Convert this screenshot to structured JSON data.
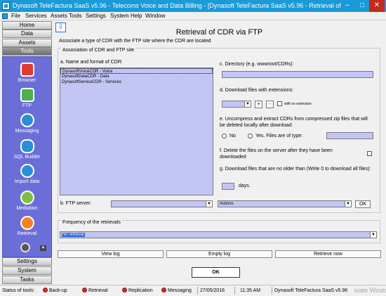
{
  "window": {
    "title": "Dynasoft TeleFactura SaaS v5.96 - Telecoms Voice and Data Billing - [Dynasoft TeleFactura SaaS v5.96 - Retrieval of CDR v",
    "minimize": "–",
    "maximize": "□",
    "close": "✕"
  },
  "menu": [
    "File",
    "Services",
    "Assets",
    "Tools",
    "Settings",
    "System",
    "Help",
    "Window"
  ],
  "sidebar": {
    "sections_top": [
      "Home",
      "Data",
      "Assets",
      "Tools"
    ],
    "tools": [
      {
        "label": "Browser",
        "icon": "browser-icon"
      },
      {
        "label": "FTP",
        "icon": "ftp-icon"
      },
      {
        "label": "Messaging",
        "icon": "messaging-icon"
      },
      {
        "label": "SQL Builder",
        "icon": "sql-builder-icon"
      },
      {
        "label": "Import data",
        "icon": "import-data-icon"
      },
      {
        "label": "Mediation",
        "icon": "mediation-icon"
      },
      {
        "label": "Retrieval",
        "icon": "retrieval-icon"
      }
    ],
    "sections_bottom": [
      "Settings",
      "System",
      "Tasks"
    ],
    "dropdown_arrow": "▼"
  },
  "main": {
    "back_arrow": "⇩",
    "title": "Retrieval of CDR via FTP",
    "description": "Associate a type of CDR with the FTP site where the CDR are located",
    "association_legend": "Association of CDR and FTP site",
    "cdr_label": "a. Name and format of CDR:",
    "cdr_items": [
      "DynasoftVoiceCDR - Voice",
      "DynasoftDataCDR - Data",
      "DynasoftServiceCDR - Services"
    ],
    "ftp_server_label": "b. FTP server:",
    "ftp_server_value": "",
    "directory_label": "c. Directory (e.g. wwwroot/CDRs):",
    "directory_value": "",
    "extensions_label": "d. Download files with extensions:",
    "extension_value": "",
    "plus_label": "+",
    "minus_label": "-",
    "no_extension_label": "with no extension",
    "uncompress_label": "e. Uncompress and extract CDRs from compressed zip files that will be deleted locally after download:",
    "radio_no": "No",
    "radio_yes": "Yes. Files are of type:",
    "file_type_value": "",
    "delete_label": "f. Delete the files on the server after they have been downloaded",
    "older_label": "g. Download files that are no older than (Write 0 to download all files):",
    "days_value": "",
    "days_label": "days.",
    "actions_value": "Actions",
    "actions_ok": "OK",
    "freq_legend": "Frequency of the retrievals",
    "freq_value": "No retrieval",
    "view_log": "View log",
    "empty_log": "Empty log",
    "retrieve_now": "Retrieve now",
    "ok": "OK",
    "arrow": "▼"
  },
  "statusbar": {
    "status_label": "Status of tools:",
    "items": [
      "Back-up",
      "Retrieval",
      "Replication",
      "Messaging"
    ],
    "date": "27/05/2016",
    "time": "11:35 AM",
    "app": "Dynasoft TeleFactura SaaS v5.96",
    "watermark": "ivate Windo"
  },
  "colors": {
    "title_bar": "#1a9ad6",
    "tools_panel": "#6b6ed6",
    "input_fill": "#c3c5f5",
    "status_red": "#d82b2b"
  }
}
